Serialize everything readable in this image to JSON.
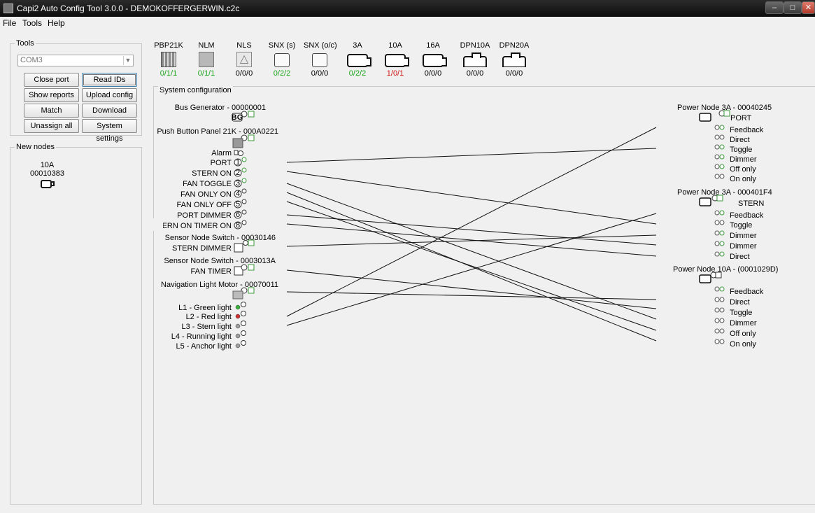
{
  "window": {
    "title": "Capi2 Auto Config Tool 3.0.0 - DEMOKOFFERGERWIN.c2c"
  },
  "menu": [
    "File",
    "Tools",
    "Help"
  ],
  "tools": {
    "legend": "Tools",
    "port_value": "COM3",
    "buttons": {
      "close_port": "Close port",
      "read_ids": "Read IDs",
      "show_reports": "Show reports",
      "upload_config": "Upload config",
      "match_randomly": "Match randomly",
      "download_config": "Download config",
      "unassign_all": "Unassign all",
      "system_settings": "System settings"
    }
  },
  "new_nodes": {
    "legend": "New nodes",
    "items": [
      {
        "type": "10A",
        "id": "00010383"
      }
    ]
  },
  "palette": [
    {
      "label": "PBP21K",
      "count": "0/1/1",
      "count_color": "#1aa31a",
      "icon": "panel-icon"
    },
    {
      "label": "NLM",
      "count": "0/1/1",
      "count_color": "#1aa31a",
      "icon": "boat-icon"
    },
    {
      "label": "NLS",
      "count": "0/0/0",
      "count_color": "#000000",
      "icon": "sailboat-icon"
    },
    {
      "label": "SNX (s)",
      "count": "0/2/2",
      "count_color": "#1aa31a",
      "icon": "switch-icon"
    },
    {
      "label": "SNX (o/c)",
      "count": "0/0/0",
      "count_color": "#000000",
      "icon": "switch-icon"
    },
    {
      "label": "3A",
      "count": "0/2/2",
      "count_color": "#1aa31a",
      "icon": "power-node-icon"
    },
    {
      "label": "10A",
      "count": "1/0/1",
      "count_color": "#d01010",
      "icon": "power-node-icon"
    },
    {
      "label": "16A",
      "count": "0/0/0",
      "count_color": "#000000",
      "icon": "power-node-icon"
    },
    {
      "label": "DPN10A",
      "count": "0/0/0",
      "count_color": "#000000",
      "icon": "dpn-icon"
    },
    {
      "label": "DPN20A",
      "count": "0/0/0",
      "count_color": "#000000",
      "icon": "dpn-icon"
    }
  ],
  "system_config": {
    "legend": "System configuration",
    "left": {
      "bus_generator": "Bus Generator - 00000001",
      "bus_generator_badge": "BG",
      "push_button_panel": "Push Button Panel 21K - 000A0221",
      "buttons": [
        {
          "label": "Alarm",
          "num": ""
        },
        {
          "label": "PORT",
          "num": "1"
        },
        {
          "label": "STERN ON",
          "num": "2"
        },
        {
          "label": "FAN TOGGLE",
          "num": "3"
        },
        {
          "label": "FAN ONLY ON",
          "num": "4"
        },
        {
          "label": "FAN ONLY OFF",
          "num": "5"
        },
        {
          "label": "PORT DIMMER",
          "num": "6"
        },
        {
          "label": "ERN ON TIMER ON",
          "num": "8"
        }
      ],
      "sensor_switch_1": "Sensor Node Switch - 00030146",
      "sensor_switch_1_label": "STERN DIMMER",
      "sensor_switch_2": "Sensor Node Switch - 0003013A",
      "sensor_switch_2_label": "FAN TIMER",
      "nav_light_motor": "Navigation Light Motor - 00070011",
      "lights": [
        {
          "label": "L1 - Green light",
          "color": "#3cb43c"
        },
        {
          "label": "L2 - Red light",
          "color": "#d03030"
        },
        {
          "label": "L3 - Stern light",
          "color": "#a0a0a0"
        },
        {
          "label": "L4 - Running light",
          "color": "#a0a0a0"
        },
        {
          "label": "L5 - Anchor light",
          "color": "#a0a0a0"
        }
      ]
    },
    "right": [
      {
        "title": "Power Node 3A - 00040245",
        "name": "PORT",
        "outputs": [
          "Feedback",
          "Direct",
          "Toggle",
          "Dimmer",
          "Off only",
          "On only"
        ]
      },
      {
        "title": "Power Node 3A - 000401F4",
        "name": "STERN",
        "outputs": [
          "Feedback",
          "Toggle",
          "Dimmer",
          "Dimmer",
          "Direct"
        ]
      },
      {
        "title": "Power Node 10A - (0001029D)",
        "name": "",
        "outputs": [
          "Feedback",
          "Direct",
          "Toggle",
          "Dimmer",
          "Off only",
          "On only"
        ]
      }
    ]
  }
}
